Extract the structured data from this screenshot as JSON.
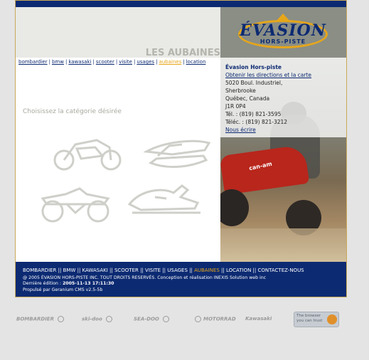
{
  "page": {
    "heading": "LES AUBAINES"
  },
  "logo": {
    "name": "ÉVASION",
    "subtitle": "HORS-PISTE"
  },
  "nav": {
    "items": [
      {
        "label": "bombardier",
        "current": false
      },
      {
        "label": "bmw",
        "current": false
      },
      {
        "label": "kawasaki",
        "current": false
      },
      {
        "label": "scooter",
        "current": false
      },
      {
        "label": "visite",
        "current": false
      },
      {
        "label": "usages",
        "current": false
      },
      {
        "label": "aubaines",
        "current": true
      },
      {
        "label": "location",
        "current": false
      }
    ],
    "separator": "|"
  },
  "categories": {
    "prompt": "Choisissez la catégorie désirée",
    "items": [
      {
        "icon": "motorcycle-icon"
      },
      {
        "icon": "watercraft-icon"
      },
      {
        "icon": "atv-icon"
      },
      {
        "icon": "snowmobile-icon"
      }
    ]
  },
  "contact": {
    "name": "Évasion Hors-piste",
    "directions": "Obtenir les directions et la carte",
    "address1": "5020 Boul. Industriel,",
    "city": "Sherbrooke",
    "region": "Québec, Canada",
    "postal": "J1R 0P4",
    "tel": "Tél. : (819) 821-3595",
    "fax": "Téléc. : (819) 821-3212",
    "email_label": "Nous écrire"
  },
  "photo": {
    "atv_brand": "can-am"
  },
  "footer": {
    "nav": [
      {
        "label": "BOMBARDIER",
        "current": false
      },
      {
        "label": "BMW",
        "current": false
      },
      {
        "label": "KAWASAKI",
        "current": false
      },
      {
        "label": "SCOOTER",
        "current": false
      },
      {
        "label": "VISITE",
        "current": false
      },
      {
        "label": "USAGES",
        "current": false
      },
      {
        "label": "AUBAINES",
        "current": true
      },
      {
        "label": "LOCATION",
        "current": false
      },
      {
        "label": "CONTACTEZ-NOUS",
        "current": false
      }
    ],
    "copyright": "@ 2005 ÉVASION HORS-PISTE INC. TOUT DROITS RESERVÉS. Conception et réalisation INEXIS Solution web inc",
    "edition_label": "Dernière édition : ",
    "edition_date": "2005-11-13 17:11:30",
    "powered": "Propulsé par Geranium CMS v2.5-5b"
  },
  "brands": {
    "items": [
      "BOMBARDIER",
      "ski-doo",
      "SEA-DOO",
      "MOTORRAD",
      "Kawasaki"
    ],
    "badge": "The browser you can trust"
  },
  "colors": {
    "navy": "#0c2a72",
    "gold": "#e6a61a",
    "frame_border": "#c9a95a",
    "background": "#e4e4e4"
  }
}
